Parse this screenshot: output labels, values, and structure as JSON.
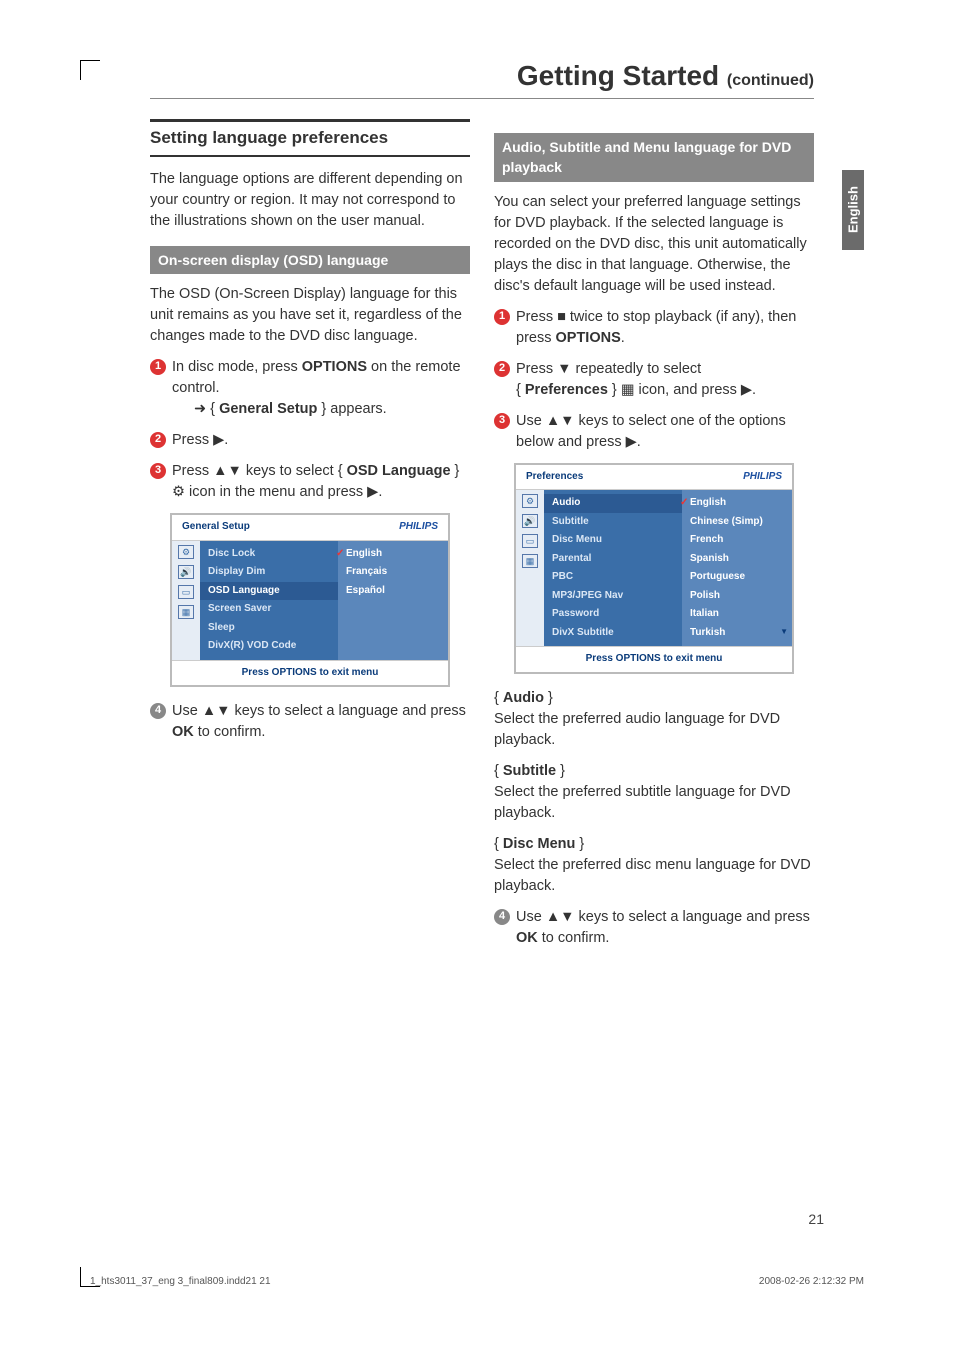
{
  "side_tab": "English",
  "page_title": "Getting Started",
  "page_title_cont": "(continued)",
  "left": {
    "section_head": "Setting language preferences",
    "intro": "The language options are different depending on your country or region. It may not correspond to the illustrations shown on the user manual.",
    "osd_head": "On-screen display (OSD) language",
    "osd_intro": "The OSD (On-Screen Display) language for this unit remains as you have set it, regardless of the changes made to the DVD disc language.",
    "step1_a": "In disc mode, press ",
    "step1_b": "OPTIONS",
    "step1_c": " on the remote control.",
    "step1_sub_arrow": "➜",
    "step1_sub_a": " { ",
    "step1_sub_b": "General Setup",
    "step1_sub_c": " } appears.",
    "step2": "Press ▶.",
    "step3_a": "Press ▲▼ keys to select { ",
    "step3_b": "OSD Language",
    "step3_c": " } ",
    "step3_d": " icon in the menu and press ▶.",
    "step4_a": "Use ▲▼ keys to select a language and press ",
    "step4_b": "OK",
    "step4_c": " to confirm."
  },
  "osd1": {
    "title": "General Setup",
    "brand": "PHILIPS",
    "items": [
      "Disc Lock",
      "Display Dim",
      "OSD Language",
      "Screen Saver",
      "Sleep",
      "DivX(R) VOD Code"
    ],
    "selected_index": 2,
    "sub": [
      "English",
      "Français",
      "Español"
    ],
    "sub_selected_index": 0,
    "footer": "Press OPTIONS to exit menu"
  },
  "right": {
    "grey_head": "Audio, Subtitle and Menu language for DVD playback",
    "intro": "You can select your preferred language settings for DVD playback. If the selected language is recorded on the DVD disc, this unit automatically plays the disc in that language. Otherwise, the disc's default language will be used instead.",
    "step1_a": "Press ■ twice to stop playback (if any), then press ",
    "step1_b": "OPTIONS",
    "step1_c": ".",
    "step2_a": "Press ▼ repeatedly to select",
    "step2_b": "{ ",
    "step2_c": "Preferences",
    "step2_d": " } ",
    "step2_e": " icon, and press ▶.",
    "step3_a": "Use ▲▼ keys to select one of the options below and press ▶.",
    "audio_head": "Audio",
    "audio_body": "Select the preferred audio language for DVD playback.",
    "subtitle_head": "Subtitle",
    "subtitle_body": "Select the preferred subtitle language for DVD playback.",
    "discmenu_head": "Disc Menu",
    "discmenu_body": "Select the preferred disc menu language for DVD playback.",
    "step4_a": "Use ▲▼ keys to select a language and press ",
    "step4_b": "OK",
    "step4_c": " to confirm."
  },
  "osd2": {
    "title": "Preferences",
    "brand": "PHILIPS",
    "items": [
      "Audio",
      "Subtitle",
      "Disc Menu",
      "Parental",
      "PBC",
      "MP3/JPEG Nav",
      "Password",
      "DivX Subtitle"
    ],
    "selected_index": 0,
    "sub": [
      "English",
      "Chinese (Simp)",
      "French",
      "Spanish",
      "Portuguese",
      "Polish",
      "Italian",
      "Turkish"
    ],
    "sub_selected_index": 0,
    "footer": "Press OPTIONS to exit menu"
  },
  "page_number": "21",
  "meta_left": "1_hts3011_37_eng 3_final809.indd21   21",
  "meta_right": "2008-02-26   2:12:32 PM"
}
